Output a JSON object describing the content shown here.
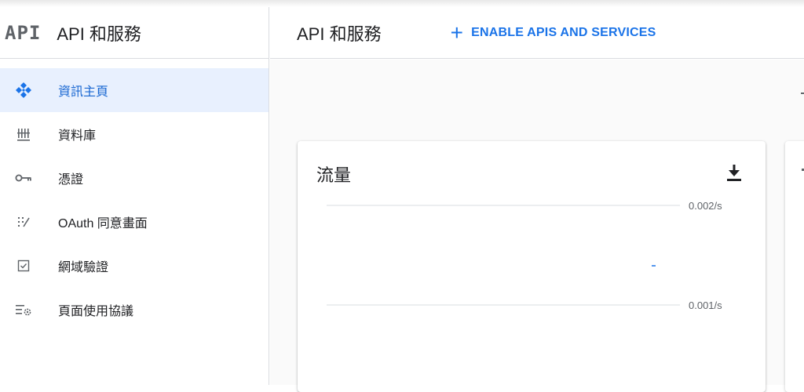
{
  "sidebar": {
    "logo": "API",
    "title": "API 和服務",
    "items": [
      {
        "label": "資訊主頁",
        "icon": "dashboard-icon",
        "active": true
      },
      {
        "label": "資料庫",
        "icon": "library-icon",
        "active": false
      },
      {
        "label": "憑證",
        "icon": "key-icon",
        "active": false
      },
      {
        "label": "OAuth 同意畫面",
        "icon": "oauth-consent-icon",
        "active": false
      },
      {
        "label": "網域驗證",
        "icon": "checkbox-icon",
        "active": false
      },
      {
        "label": "頁面使用協議",
        "icon": "settings-list-icon",
        "active": false
      }
    ]
  },
  "header": {
    "title": "API 和服務",
    "enable_button": "ENABLE APIS AND SERVICES"
  },
  "traffic_card": {
    "title": "流量",
    "download_icon": "download-icon"
  },
  "chart_data": {
    "type": "line",
    "title": "流量",
    "y_ticks": [
      "0.002/s",
      "0.001/s"
    ],
    "y_tick_values": [
      0.002,
      0.001
    ],
    "grid": true,
    "series": []
  },
  "colors": {
    "accent": "#1a73e8",
    "active_bg": "#e8f0fe",
    "text": "#202124",
    "muted": "#5f6368"
  }
}
